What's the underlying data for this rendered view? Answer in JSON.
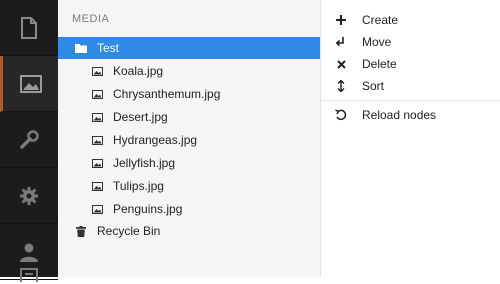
{
  "rail": {
    "items": [
      {
        "icon": "document-icon"
      },
      {
        "icon": "image-icon",
        "active": true
      },
      {
        "icon": "wrench-icon"
      },
      {
        "icon": "gear-icon"
      },
      {
        "icon": "user-icon"
      },
      {
        "icon": "form-icon"
      }
    ],
    "accent_color": "#b45a23"
  },
  "tree": {
    "section_title": "MEDIA",
    "root": {
      "label": "Test",
      "selected": true,
      "icon": "folder-icon"
    },
    "children": [
      {
        "label": "Koala.jpg",
        "icon": "image-file-icon"
      },
      {
        "label": "Chrysanthemum.jpg",
        "icon": "image-file-icon"
      },
      {
        "label": "Desert.jpg",
        "icon": "image-file-icon"
      },
      {
        "label": "Hydrangeas.jpg",
        "icon": "image-file-icon"
      },
      {
        "label": "Jellyfish.jpg",
        "icon": "image-file-icon"
      },
      {
        "label": "Tulips.jpg",
        "icon": "image-file-icon"
      },
      {
        "label": "Penguins.jpg",
        "icon": "image-file-icon"
      }
    ],
    "recycle_bin": {
      "label": "Recycle Bin",
      "icon": "trash-icon"
    },
    "selected_color": "#2e8ae6"
  },
  "menu": {
    "items": [
      {
        "label": "Create",
        "icon": "plus-icon"
      },
      {
        "label": "Move",
        "icon": "move-icon"
      },
      {
        "label": "Delete",
        "icon": "close-icon"
      },
      {
        "label": "Sort",
        "icon": "sort-icon"
      }
    ],
    "secondary": [
      {
        "label": "Reload nodes",
        "icon": "reload-icon"
      }
    ]
  }
}
